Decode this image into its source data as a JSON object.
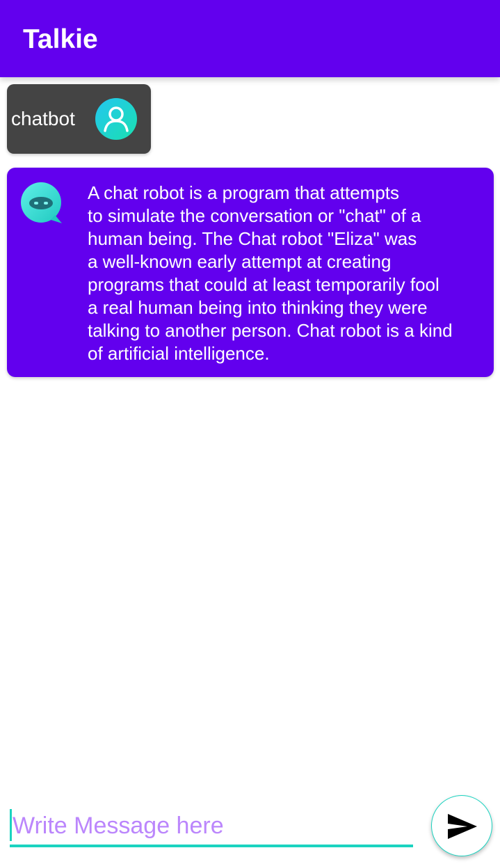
{
  "app_bar": {
    "title": "Talkie",
    "background": "#6200EE"
  },
  "messages": [
    {
      "sender": "user",
      "text": "chatbot",
      "bubble_color": "#444444",
      "avatar_icon": "user-avatar-icon"
    },
    {
      "sender": "bot",
      "text": "A chat robot is a program that attempts\nto simulate the conversation or \"chat\" of a\nhuman being. The Chat robot \"Eliza\" was\na well-known early attempt at creating\nprograms that could at least temporarily fool\na real human being into thinking they were\ntalking to another person. Chat robot is a kind\nof artificial intelligence.",
      "bubble_color": "#6200EE",
      "avatar_icon": "robot-avatar-icon"
    }
  ],
  "composer": {
    "placeholder": "Write Message here",
    "value": "",
    "accent": "#1BD3C0",
    "placeholder_color": "#BB86FC",
    "send_icon": "send-icon"
  }
}
